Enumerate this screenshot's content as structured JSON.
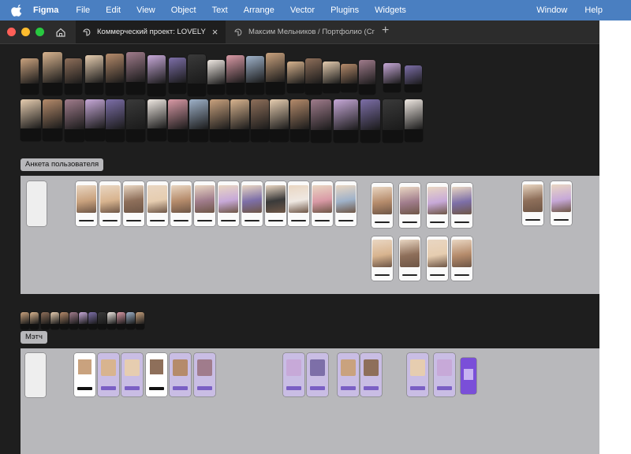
{
  "menubar": {
    "app": "Figma",
    "items": [
      "File",
      "Edit",
      "View",
      "Object",
      "Text",
      "Arrange",
      "Vector",
      "Plugins",
      "Widgets"
    ],
    "right_items": [
      "Window",
      "Help"
    ]
  },
  "tabs": [
    {
      "label": "Коммерческий проект: LOVELY",
      "active": true
    },
    {
      "label": "Максим Мельников / Портфолио (Cr",
      "active": false
    }
  ],
  "sections": {
    "profile": "Анкета пользователя",
    "match": "Мэтч"
  },
  "colors": {
    "menubar": "#4a7fc1",
    "tabbar": "#2c2c2c",
    "canvas": "#1e1e1e",
    "section": "#b8b8bb",
    "close": "#ff5f57",
    "minimize": "#febc2e",
    "zoom": "#28c840"
  }
}
